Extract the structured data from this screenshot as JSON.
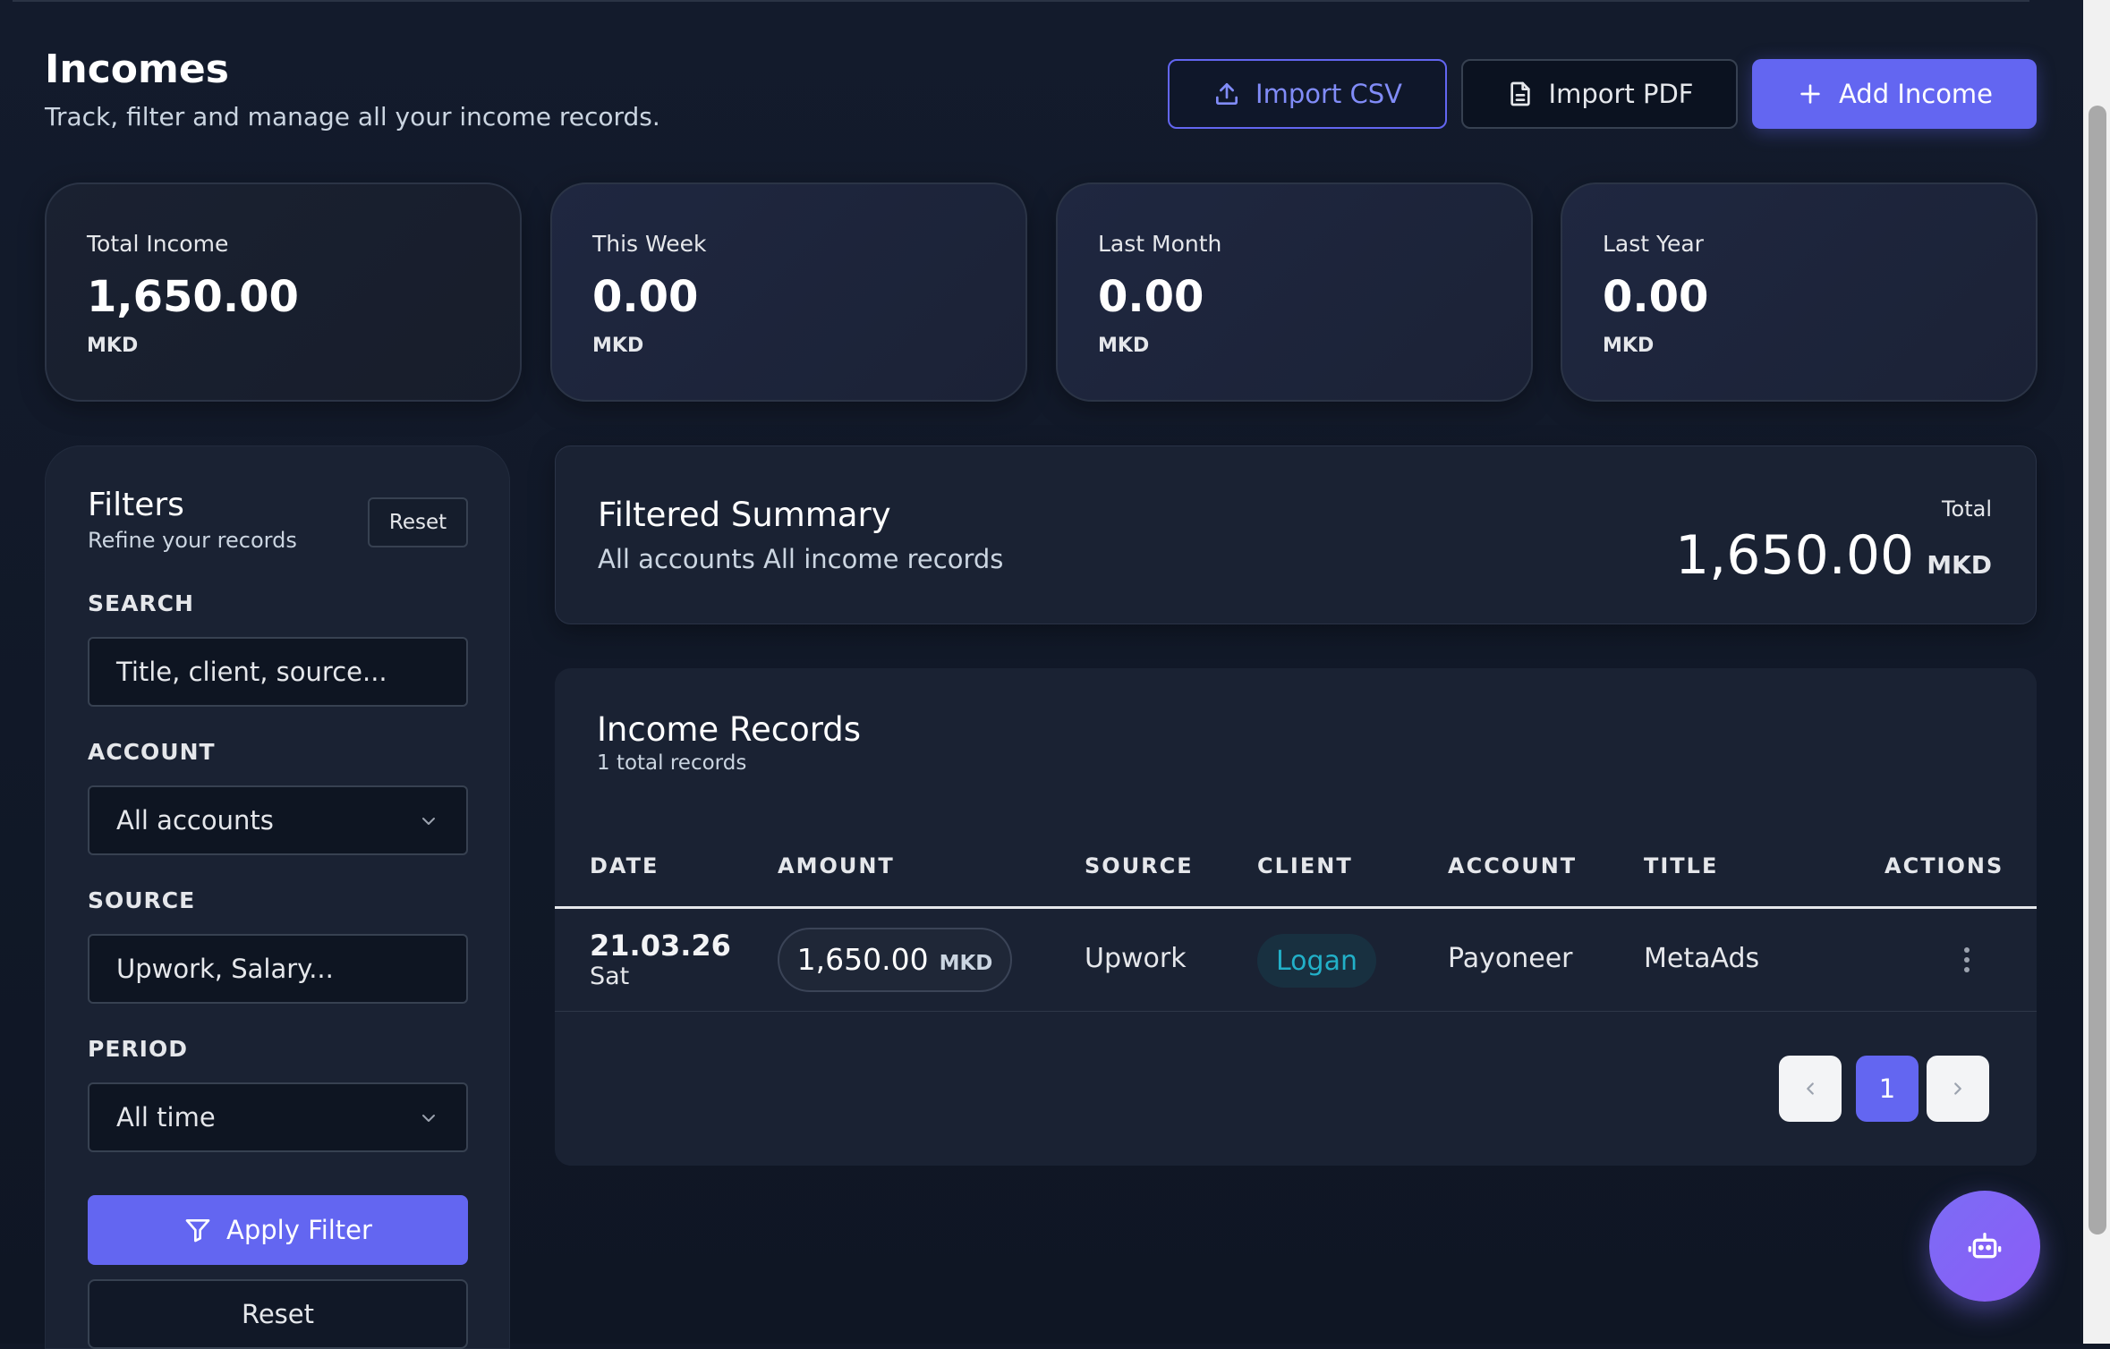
{
  "header": {
    "title": "Incomes",
    "subtitle": "Track, filter and manage all your income records.",
    "import_csv_label": "Import CSV",
    "import_pdf_label": "Import PDF",
    "add_income_label": "Add Income"
  },
  "stats": [
    {
      "label": "Total Income",
      "value": "1,650.00",
      "currency": "MKD"
    },
    {
      "label": "This Week",
      "value": "0.00",
      "currency": "MKD"
    },
    {
      "label": "Last Month",
      "value": "0.00",
      "currency": "MKD"
    },
    {
      "label": "Last Year",
      "value": "0.00",
      "currency": "MKD"
    }
  ],
  "filters": {
    "title": "Filters",
    "subtitle": "Refine your records",
    "reset_label": "Reset",
    "search_label": "SEARCH",
    "search_placeholder": "Title, client, source...",
    "account_label": "ACCOUNT",
    "account_value": "All accounts",
    "source_label": "SOURCE",
    "source_placeholder": "Upwork, Salary...",
    "period_label": "PERIOD",
    "period_value": "All time",
    "apply_label": "Apply Filter",
    "reset_button_label": "Reset"
  },
  "summary": {
    "title": "Filtered Summary",
    "subtitle": "All accounts All income records",
    "total_label": "Total",
    "total_value": "1,650.00",
    "total_currency": "MKD"
  },
  "records": {
    "title": "Income Records",
    "count_text": "1 total records",
    "columns": [
      "DATE",
      "AMOUNT",
      "SOURCE",
      "CLIENT",
      "ACCOUNT",
      "TITLE",
      "ACTIONS"
    ],
    "rows": [
      {
        "date": "21.03.26",
        "day": "Sat",
        "amount": "1,650.00",
        "currency": "MKD",
        "source": "Upwork",
        "client": "Logan",
        "account": "Payoneer",
        "title": "MetaAds"
      }
    ]
  },
  "pagination": {
    "current_page": "1"
  },
  "colors": {
    "accent": "#6366f1",
    "background": "#111827",
    "card": "#1a2233",
    "client_badge": "#22b0c8"
  },
  "icons": {
    "import_csv": "upload-icon",
    "import_pdf": "file-icon",
    "add_income": "plus-icon",
    "apply_filter": "filter-icon",
    "fab": "robot-icon"
  }
}
